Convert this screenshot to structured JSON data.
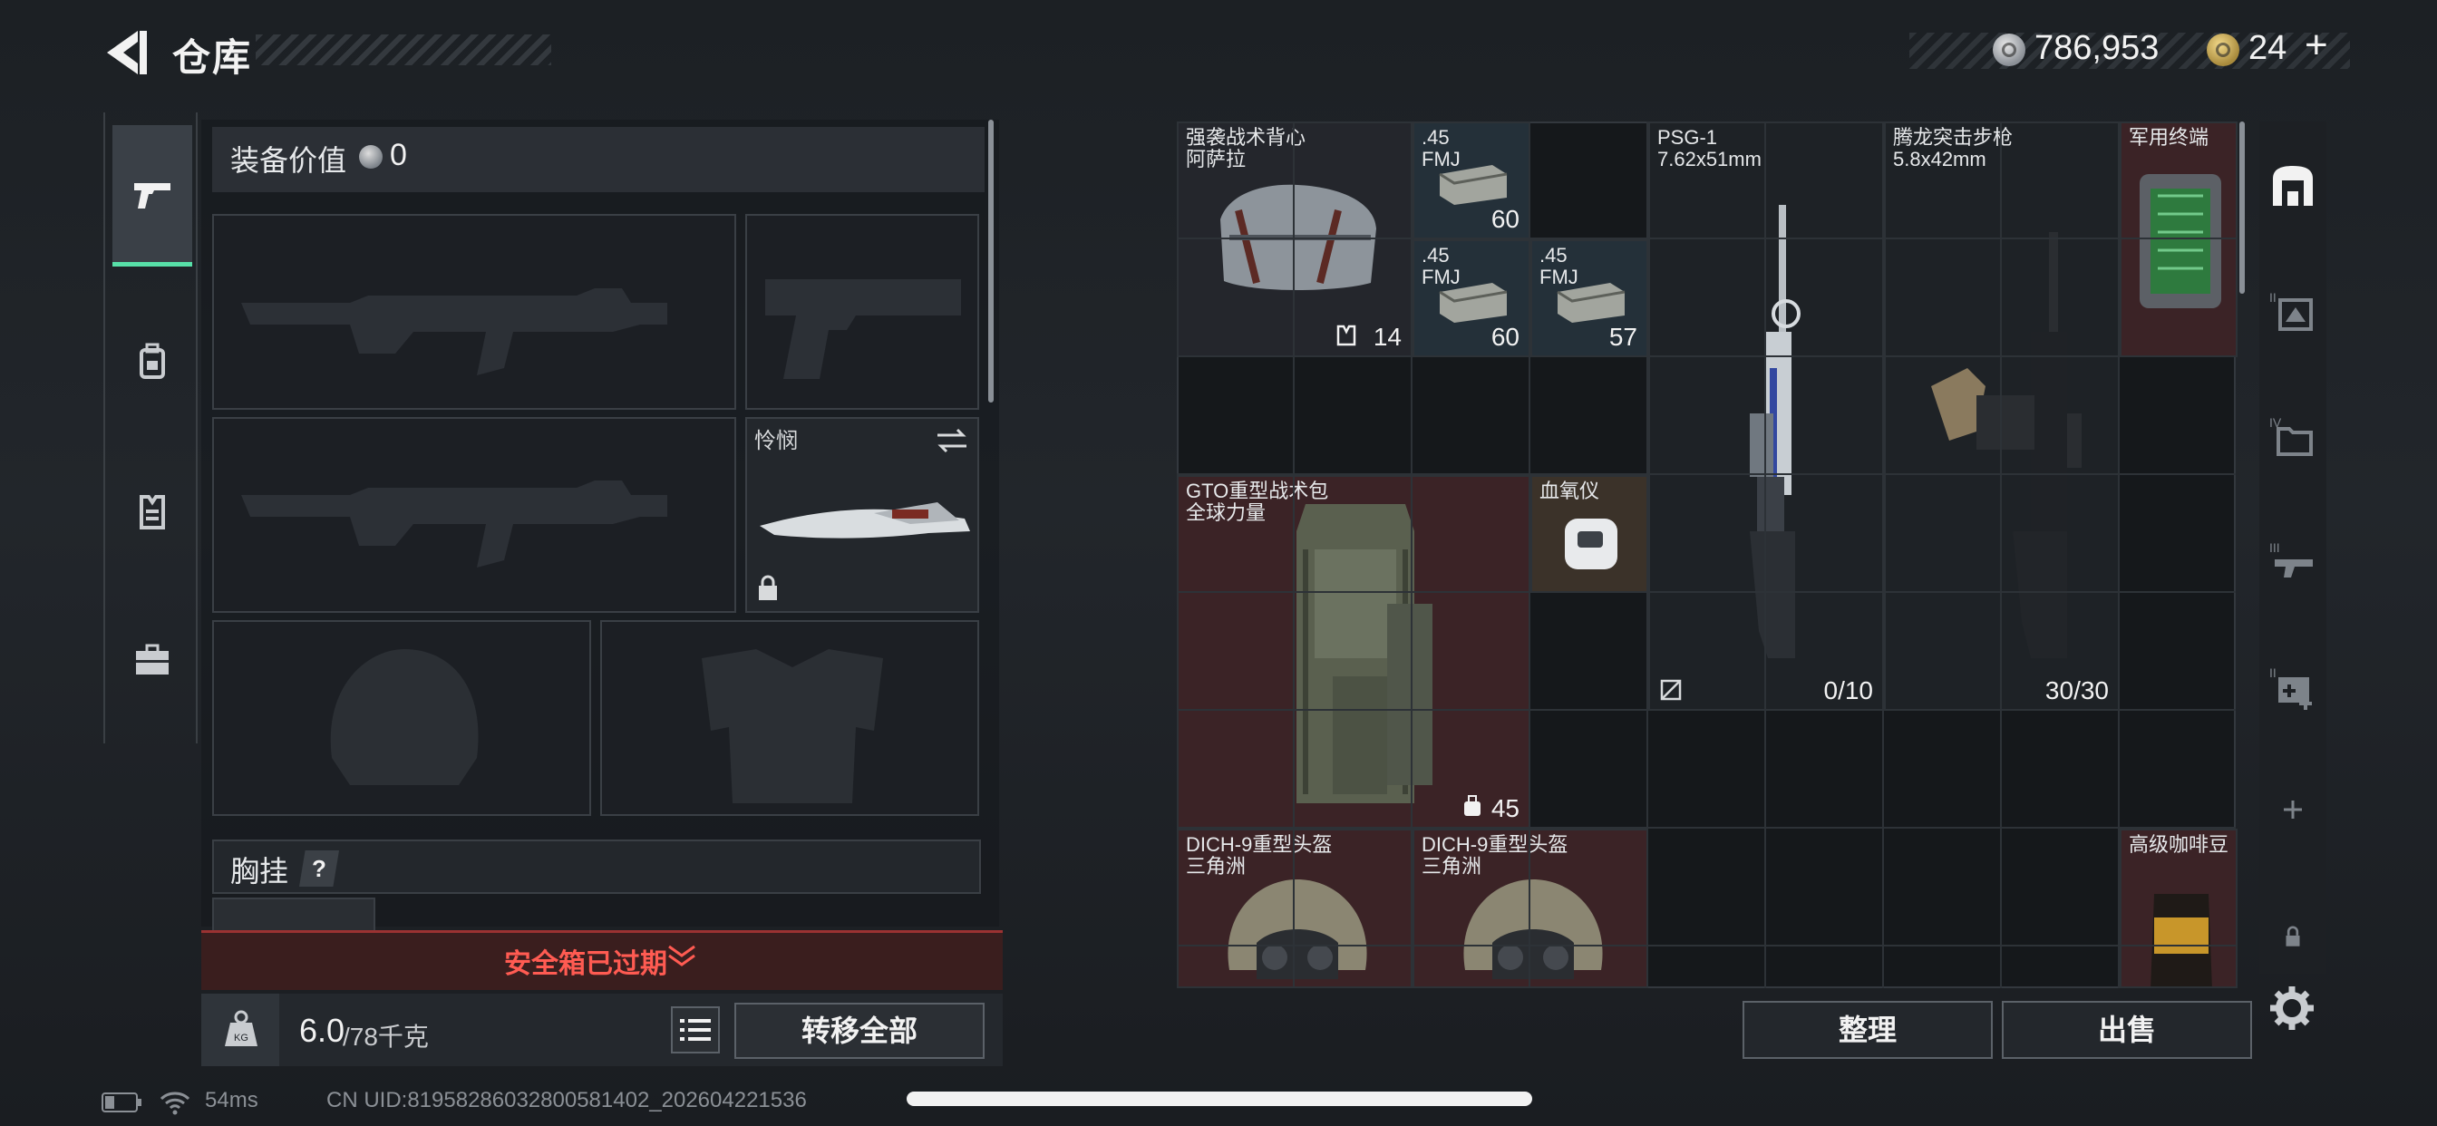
{
  "header": {
    "title": "仓库",
    "currency_silver": "786,953",
    "currency_gold": "24",
    "plus_label": "+"
  },
  "left_tabs": [
    {
      "name": "weapons-tab",
      "icon": "pistol-icon",
      "active": true
    },
    {
      "name": "gear-tab",
      "icon": "backpack-icon",
      "active": false
    },
    {
      "name": "vest-tab",
      "icon": "vest-icon",
      "active": false
    },
    {
      "name": "medkit-tab",
      "icon": "toolbox-icon",
      "active": false
    }
  ],
  "loadout": {
    "equip_value_label": "装备价值",
    "equip_value": "0",
    "melee_label": "怜悯",
    "chest_label": "胸挂",
    "help_label": "?",
    "safe_box_status": "安全箱已过期",
    "weight_current": "6.0",
    "weight_max": "/78千克",
    "transfer_all": "转移全部"
  },
  "storage": {
    "items": [
      {
        "id": "assault-vest",
        "name": "强袭战术背心\n阿萨拉",
        "count": "14"
      },
      {
        "id": "ammo-45-a",
        "name": ".45\nFMJ",
        "count": "60"
      },
      {
        "id": "ammo-45-b",
        "name": ".45\nFMJ",
        "count": "60"
      },
      {
        "id": "ammo-45-c",
        "name": ".45\nFMJ",
        "count": "57"
      },
      {
        "id": "psg1",
        "name": "PSG-1\n7.62x51mm",
        "count": "0/10"
      },
      {
        "id": "tenglong",
        "name": "腾龙突击步枪\n5.8x42mm",
        "count": "30/30"
      },
      {
        "id": "mil-terminal",
        "name": "军用终端",
        "count": ""
      },
      {
        "id": "gto-pack",
        "name": "GTO重型战术包\n全球力量",
        "count": "45"
      },
      {
        "id": "oximeter",
        "name": "血氧仪",
        "count": ""
      },
      {
        "id": "helmet-a",
        "name": "DICH-9重型头盔\n三角洲",
        "count": ""
      },
      {
        "id": "helmet-b",
        "name": "DICH-9重型头盔\n三角洲",
        "count": ""
      },
      {
        "id": "coffee",
        "name": "高级咖啡豆",
        "count": ""
      }
    ],
    "sort_label": "整理",
    "sell_label": "出售"
  },
  "right_tabs": [
    {
      "label": "",
      "icon": "stash-icon"
    },
    {
      "label": "II",
      "icon": "stash-2-icon"
    },
    {
      "label": "IV",
      "icon": "stash-4-icon"
    },
    {
      "label": "III",
      "icon": "stash-3-icon"
    },
    {
      "label": "II",
      "icon": "stash-2b-icon"
    },
    {
      "label": "+",
      "icon": "add-tab-icon"
    },
    {
      "label": "",
      "icon": "lock-icon"
    },
    {
      "label": "",
      "icon": "gear-icon"
    }
  ],
  "status_bar": {
    "ping": "54ms",
    "uid": "CN UID:8195828603280058140​2_202604221536"
  },
  "colors": {
    "accent_green": "#57e0a8",
    "warning_red": "#ff5b52"
  }
}
